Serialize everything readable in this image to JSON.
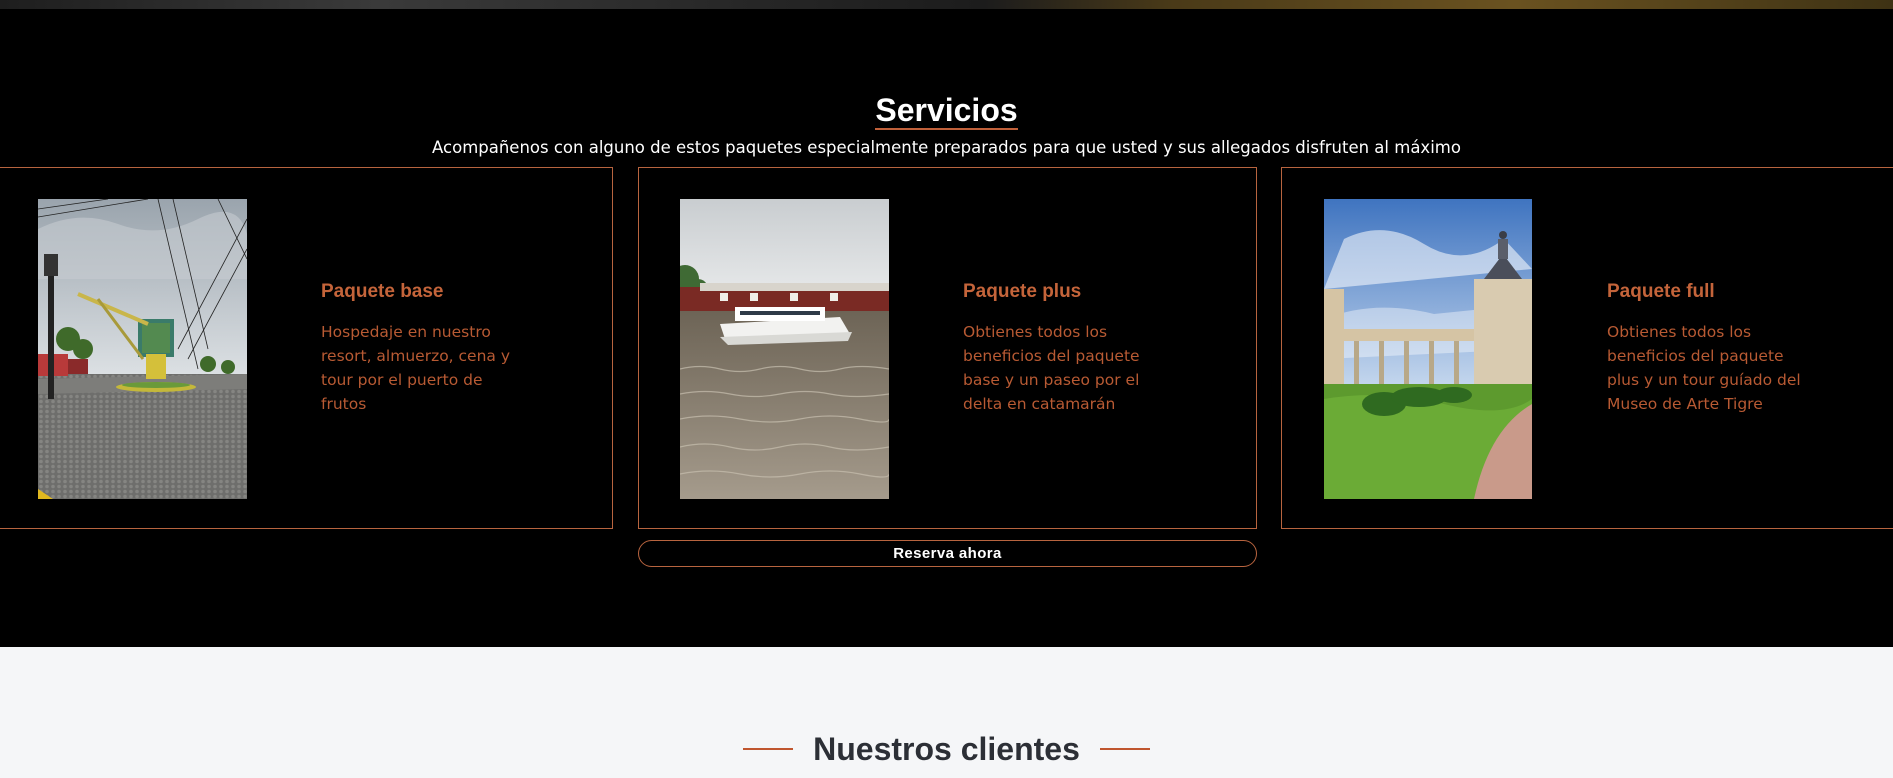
{
  "services": {
    "title": "Servicios",
    "subtitle": "Acompañenos con alguno de estos paquetes especialmente preparados para que usted y sus allegados disfruten al máximo",
    "cards": [
      {
        "title": "Paquete base",
        "description": "Hospedaje en nuestro resort, almuerzo, cena y tour por el puerto de frutos",
        "photo": "plaza-crane-photo"
      },
      {
        "title": "Paquete plus",
        "description": "Obtienes todos los beneficios del paquete base y un paseo por el delta en catamarán",
        "photo": "river-catamaran-photo"
      },
      {
        "title": "Paquete full",
        "description": "Obtienes todos los beneficios del paquete plus y un tour guíado del Museo de Arte Tigre",
        "photo": "museum-garden-photo"
      }
    ],
    "reserve_label": "Reserva ahora"
  },
  "clients": {
    "title": "Nuestros clientes"
  },
  "colors": {
    "accent": "#c0603a",
    "background_dark": "#000000",
    "background_light": "#f5f6f8",
    "clients_title": "#2c2f36"
  }
}
